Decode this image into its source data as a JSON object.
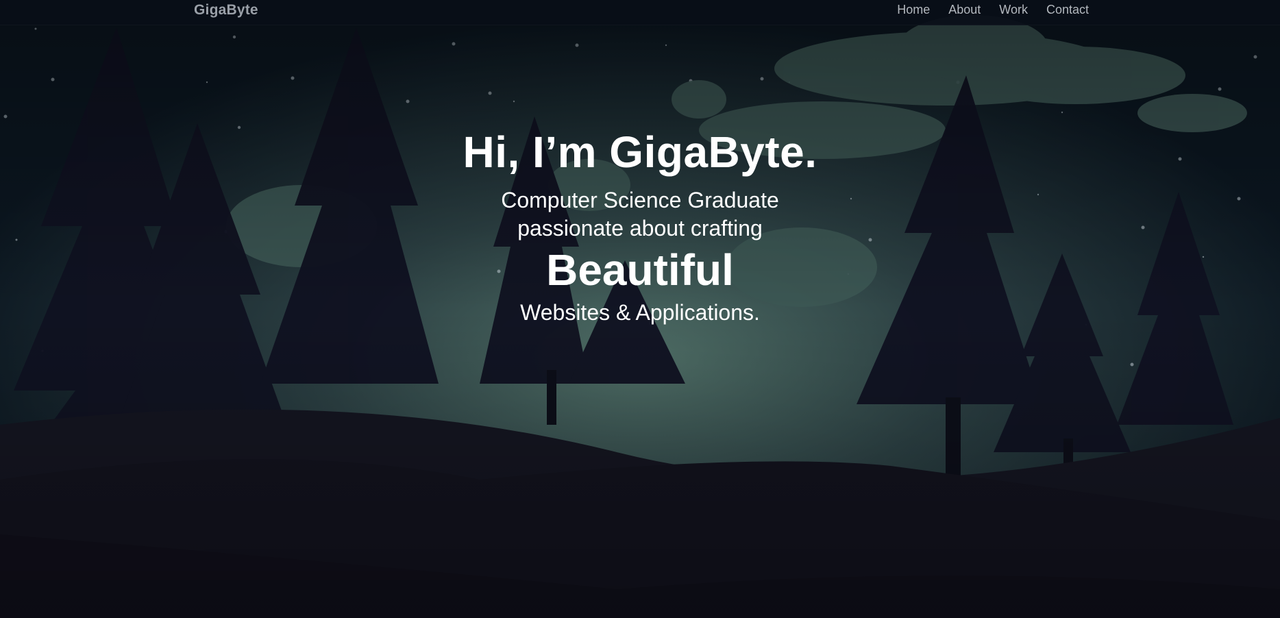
{
  "navbar": {
    "brand": "GigaByte",
    "links": [
      "Home",
      "About",
      "Work",
      "Contact"
    ]
  },
  "hero": {
    "title": "Hi, I’m GigaByte.",
    "subtitle_line1": "Computer Science Graduate",
    "subtitle_line2": "passionate about crafting",
    "highlight": "Beautiful",
    "tail": "Websites & Applications."
  },
  "colors": {
    "sky": "#0b1620",
    "glow": "#4f6e66",
    "tree": "#0f1220",
    "ground": "#12121c",
    "text": "#ffffff",
    "nav_text": "#b3b8be"
  }
}
